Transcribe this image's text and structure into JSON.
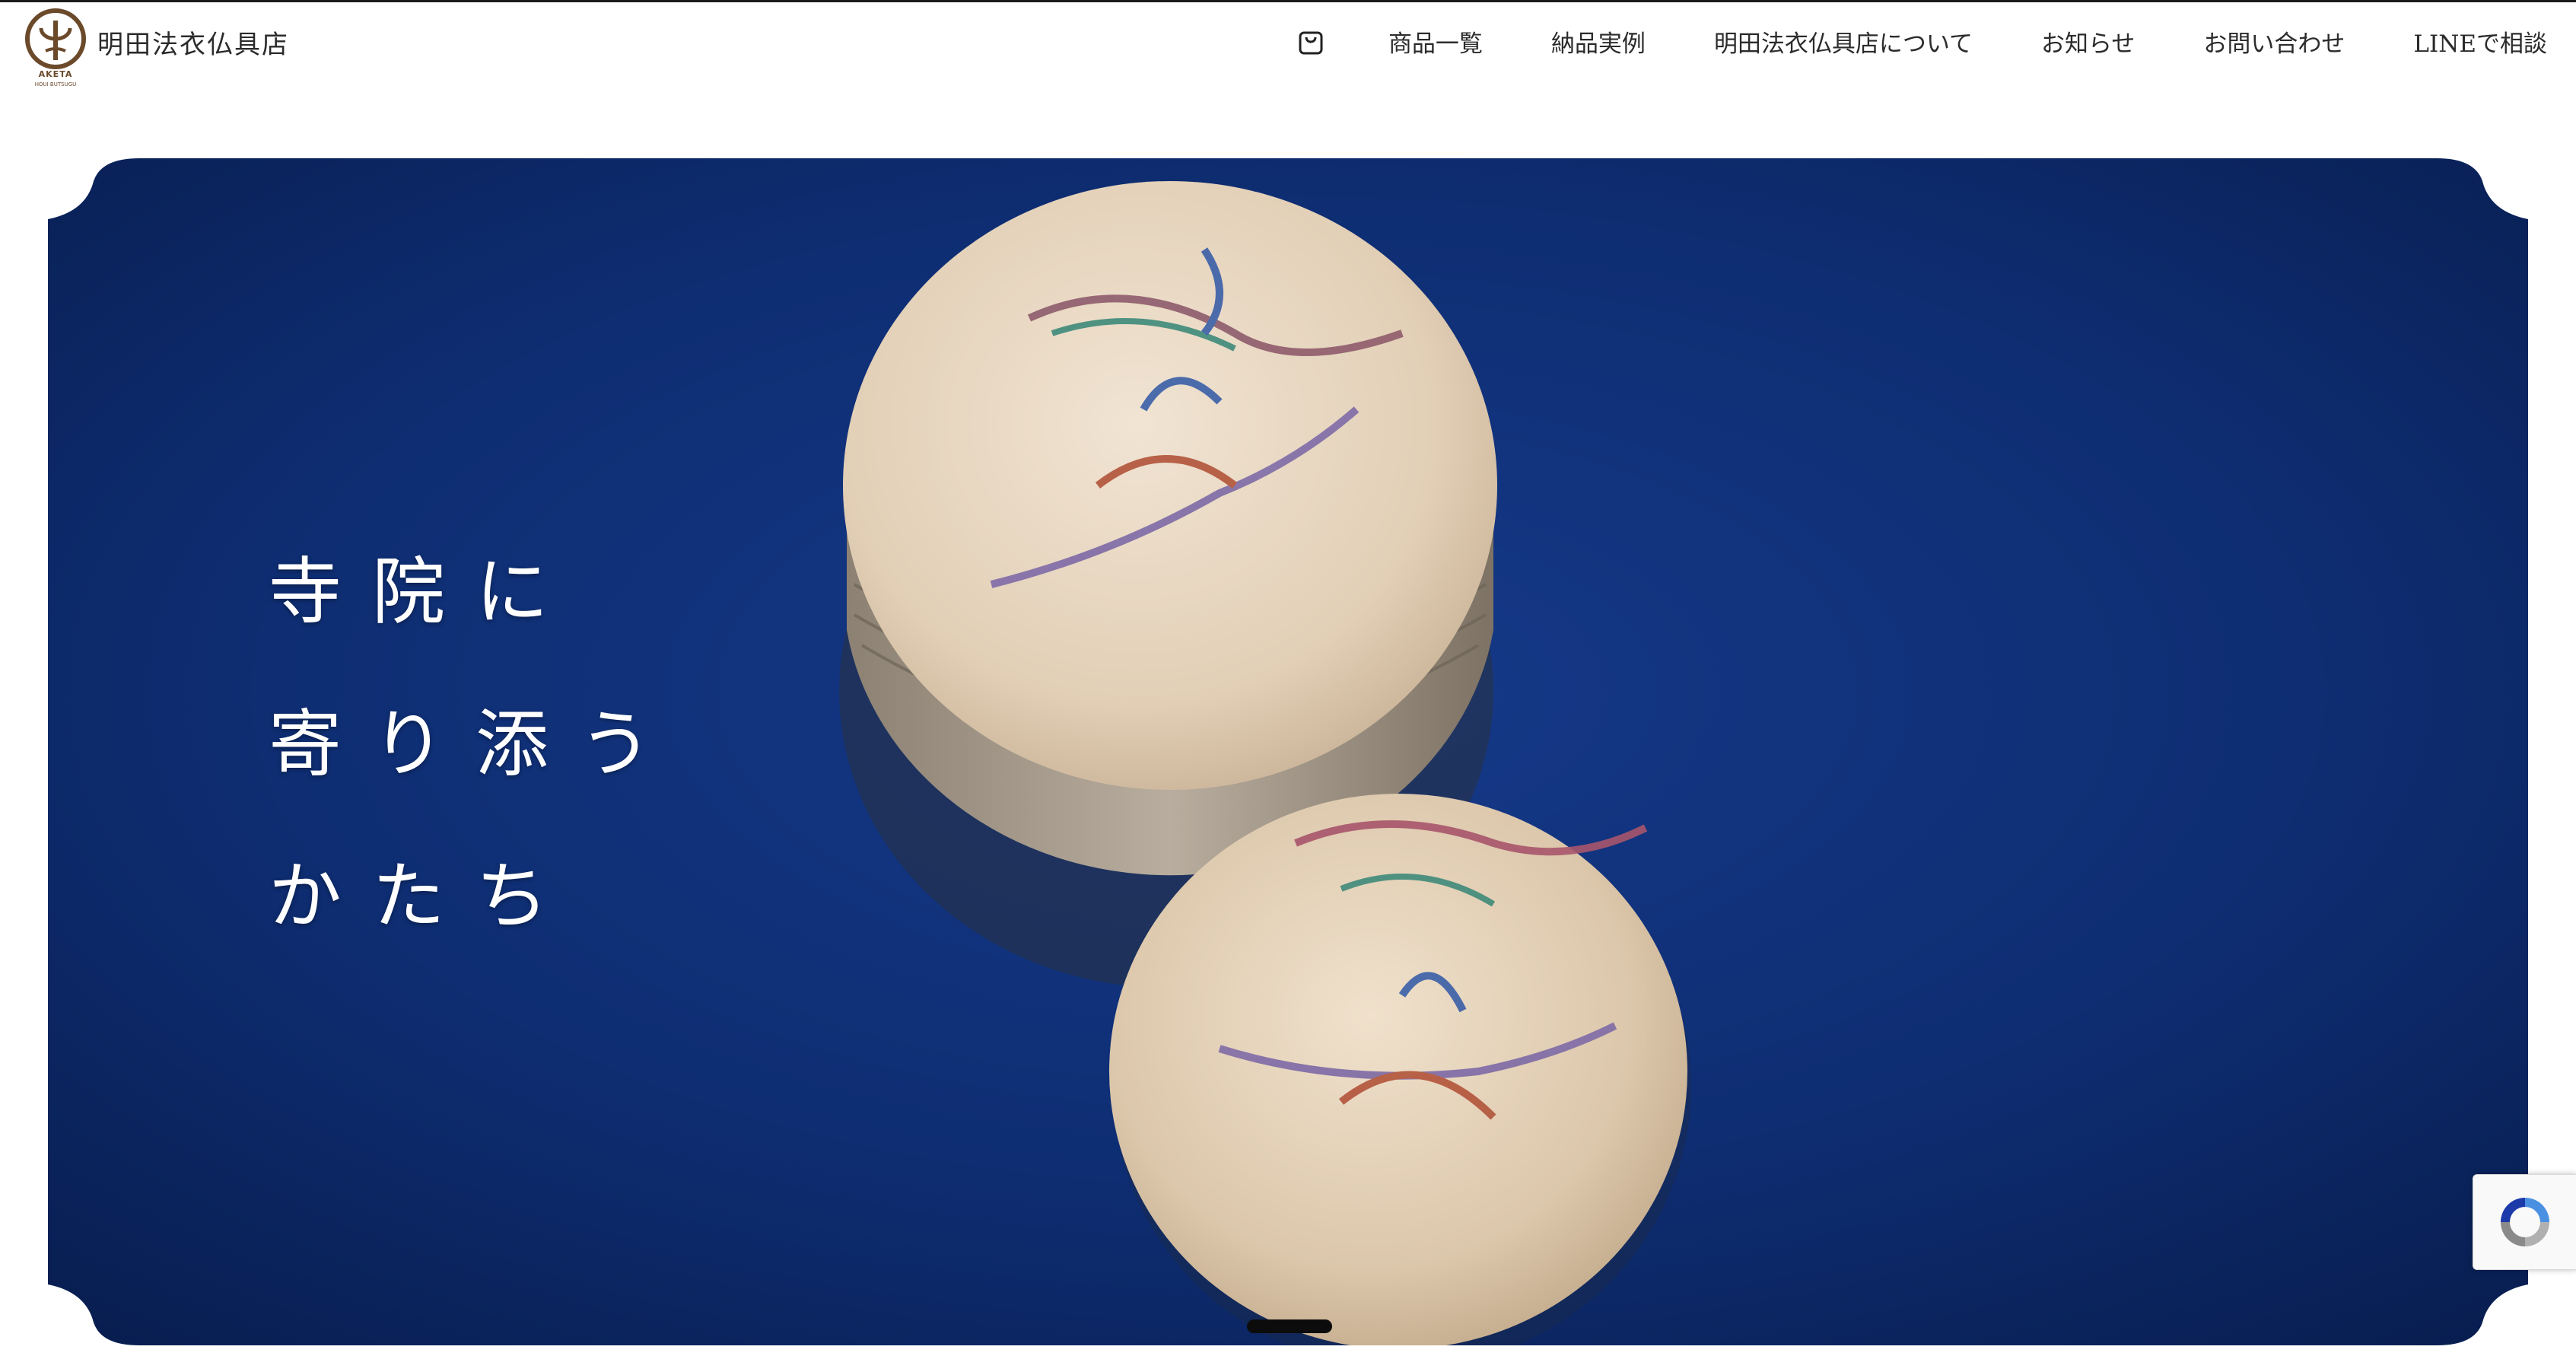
{
  "header": {
    "brand_name": "明田法衣仏具店",
    "logo_text_top": "AKETA",
    "logo_text_bottom": "HOUI BUTSUGU",
    "logo_color": "#6b4a2b",
    "nav": [
      {
        "label": "商品一覧"
      },
      {
        "label": "納品実例"
      },
      {
        "label": "明田法衣仏具店について"
      },
      {
        "label": "お知らせ"
      },
      {
        "label": "お問い合わせ"
      },
      {
        "label": "LINEで相談"
      }
    ],
    "cart_icon": "shopping-bag-icon"
  },
  "hero": {
    "lines": [
      "寺院に",
      "寄り添う",
      "かたち"
    ],
    "background_color": "#0d2a6b",
    "image_subject": "two round lacquered wooden boxes with phoenix motif on navy velvet"
  },
  "badge": {
    "icon": "recaptcha-icon"
  }
}
